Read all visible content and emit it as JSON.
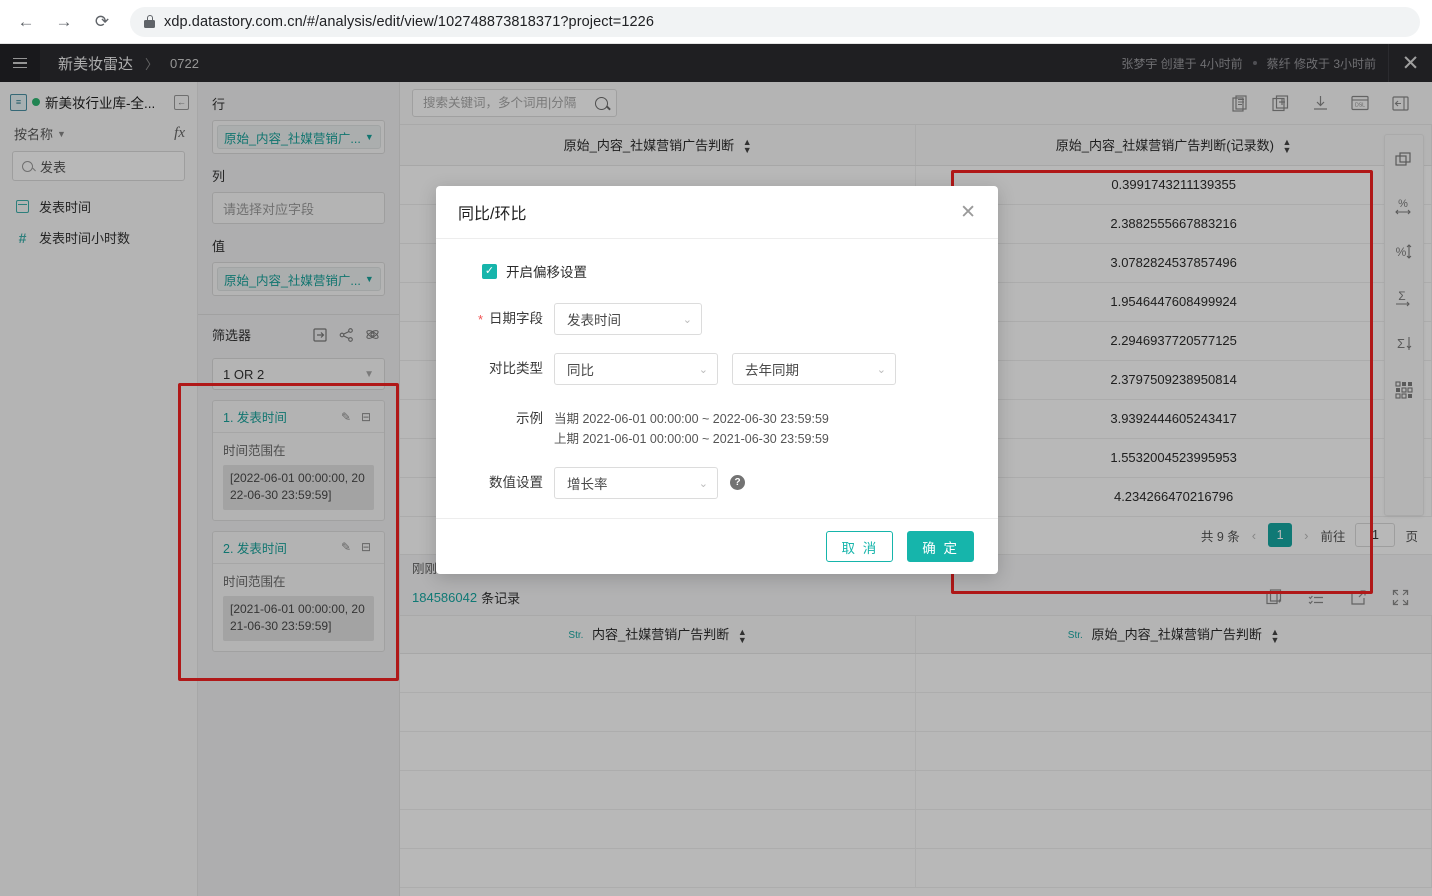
{
  "browser": {
    "back_icon": "back-arrow-icon",
    "forward_icon": "forward-arrow-icon",
    "reload_icon": "reload-icon",
    "url": "xdp.datastory.com.cn/#/analysis/edit/view/102748873818371?project=1226"
  },
  "header": {
    "breadcrumb_main": "新美妆雷达",
    "breadcrumb_sep": "〉",
    "breadcrumb_sub": "0722",
    "created_by": "张梦宇 创建于 4小时前",
    "modified_by": "蔡纤 修改于 3小时前",
    "close_label": "✕"
  },
  "field_panel": {
    "datasource_name": "新美妆行业库-全...",
    "sort_label": "按名称",
    "fx_label": "fx",
    "search_value": "发表",
    "fields": [
      {
        "icon": "calendar-icon",
        "label": "发表时间"
      },
      {
        "icon": "hash-icon",
        "label": "发表时间小时数"
      }
    ]
  },
  "shelf_panel": {
    "rows_label": "行",
    "rows_value": "原始_内容_社媒营销广...",
    "cols_label": "列",
    "cols_placeholder": "请选择对应字段",
    "values_label": "值",
    "values_value": "原始_内容_社媒营销广...",
    "filter_title": "筛选器",
    "logic_value": "1 OR 2",
    "filters": [
      {
        "title": "1. 发表时间",
        "operator": "时间范围在",
        "value": "[2022-06-01 00:00:00, 2022-06-30 23:59:59]"
      },
      {
        "title": "2. 发表时间",
        "operator": "时间范围在",
        "value": "[2021-06-01 00:00:00, 2021-06-30 23:59:59]"
      }
    ]
  },
  "canvas": {
    "search_placeholder": "搜索关键词，多个词用|分隔",
    "search_value": "",
    "toolbar_icons": [
      "document-icon",
      "add-card-icon",
      "download-icon",
      "dsl-icon",
      "collapse-panel-icon"
    ],
    "refresh_label": "刚刚"
  },
  "pivot_table": {
    "columns": [
      "原始_内容_社媒营销广告判断",
      "原始_内容_社媒营销广告判断(记录数)"
    ],
    "rows": [
      {
        "c0": "",
        "c1": "0.3991743211139355"
      },
      {
        "c0": "",
        "c1": "2.3882555667883216"
      },
      {
        "c0": "",
        "c1": "3.0782824537857496"
      },
      {
        "c0": "",
        "c1": "1.9546447608499924"
      },
      {
        "c0": "",
        "c1": "2.2946937720577125"
      },
      {
        "c0": "",
        "c1": "2.3797509238950814"
      },
      {
        "c0": "",
        "c1": "3.9392444605243417"
      },
      {
        "c0": "",
        "c1": "1.5532004523995953"
      },
      {
        "c0": "",
        "c1": "4.234266470216796"
      }
    ],
    "pagination": {
      "total_label": "共 9 条",
      "prev": "‹",
      "current_page": "1",
      "next": "›",
      "goto_label": "前往",
      "goto_value": "1",
      "page_unit": "页"
    }
  },
  "raw_table": {
    "record_count": "184586042",
    "record_suffix": "条记录",
    "type_tag": "Str.",
    "columns": [
      "内容_社媒营销广告判断",
      "原始_内容_社媒营销广告判断"
    ],
    "empty_row_count": 6,
    "tools": [
      "duplicate-icon",
      "list-icon",
      "export-icon",
      "fullscreen-icon"
    ]
  },
  "rail": {
    "icons": [
      "layers-icon",
      "percent-row-icon",
      "percent-column-icon",
      "sum-row-icon",
      "sum-column-icon",
      "grid-icon"
    ]
  },
  "modal": {
    "title": "同比/环比",
    "close": "✕",
    "checkbox_label": "开启偏移设置",
    "checkbox_checked": true,
    "date_field_label": "日期字段",
    "date_field_value": "发表时间",
    "compare_type_label": "对比类型",
    "compare_type_value": "同比",
    "compare_period_value": "去年同期",
    "sample_label": "示例",
    "sample_current": "当期 2022-06-01 00:00:00 ~ 2022-06-30 23:59:59",
    "sample_previous": "上期 2021-06-01 00:00:00 ~ 2021-06-30 23:59:59",
    "value_setting_label": "数值设置",
    "value_setting_value": "增长率",
    "help_icon": "help-icon",
    "cancel_label": "取 消",
    "confirm_label": "确 定"
  },
  "colors": {
    "accent": "#16b5ab",
    "highlight_box": "#f42222",
    "header_bg": "#2b2b30"
  }
}
